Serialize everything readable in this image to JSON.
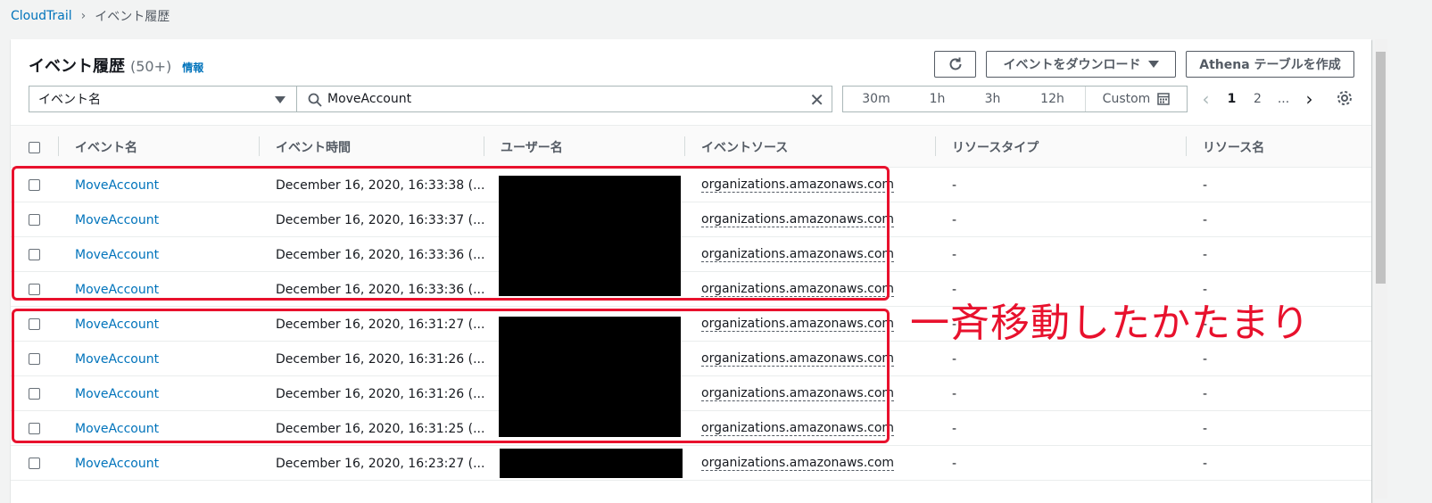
{
  "breadcrumb": {
    "root": "CloudTrail",
    "current": "イベント履歴"
  },
  "header": {
    "title": "イベント履歴",
    "count": "(50+)",
    "info_link": "情報"
  },
  "toolbar": {
    "download_label": "イベントをダウンロード",
    "athena_label": "Athena テーブルを作成"
  },
  "filter": {
    "attribute": "イベント名",
    "search_value": "MoveAccount"
  },
  "time_range": {
    "options": [
      "30m",
      "1h",
      "3h",
      "12h"
    ],
    "custom_label": "Custom"
  },
  "pagination": {
    "pages": [
      "1",
      "2",
      "..."
    ],
    "current": "1"
  },
  "table": {
    "columns": [
      "イベント名",
      "イベント時間",
      "ユーザー名",
      "イベントソース",
      "リソースタイプ",
      "リソース名"
    ],
    "rows": [
      {
        "event_name": "MoveAccount",
        "event_time": "December 16, 2020, 16:33:38 (...",
        "event_source": "organizations.amazonaws.com",
        "resource_type": "-",
        "resource_name": "-"
      },
      {
        "event_name": "MoveAccount",
        "event_time": "December 16, 2020, 16:33:37 (...",
        "event_source": "organizations.amazonaws.com",
        "resource_type": "-",
        "resource_name": "-"
      },
      {
        "event_name": "MoveAccount",
        "event_time": "December 16, 2020, 16:33:36 (...",
        "event_source": "organizations.amazonaws.com",
        "resource_type": "-",
        "resource_name": "-"
      },
      {
        "event_name": "MoveAccount",
        "event_time": "December 16, 2020, 16:33:36 (...",
        "event_source": "organizations.amazonaws.com",
        "resource_type": "-",
        "resource_name": "-"
      },
      {
        "event_name": "MoveAccount",
        "event_time": "December 16, 2020, 16:31:27 (...",
        "event_source": "organizations.amazonaws.com",
        "resource_type": "-",
        "resource_name": "-"
      },
      {
        "event_name": "MoveAccount",
        "event_time": "December 16, 2020, 16:31:26 (...",
        "event_source": "organizations.amazonaws.com",
        "resource_type": "-",
        "resource_name": "-"
      },
      {
        "event_name": "MoveAccount",
        "event_time": "December 16, 2020, 16:31:26 (...",
        "event_source": "organizations.amazonaws.com",
        "resource_type": "-",
        "resource_name": "-"
      },
      {
        "event_name": "MoveAccount",
        "event_time": "December 16, 2020, 16:31:25 (...",
        "event_source": "organizations.amazonaws.com",
        "resource_type": "-",
        "resource_name": "-"
      },
      {
        "event_name": "MoveAccount",
        "event_time": "December 16, 2020, 16:23:27 (...",
        "event_source": "organizations.amazonaws.com",
        "resource_type": "-",
        "resource_name": "-"
      }
    ]
  },
  "annotation": {
    "text": "一斉移動したかたまり",
    "color": "#e8112d"
  },
  "colors": {
    "link": "#0073bb",
    "text": "#16191f",
    "muted": "#545b64"
  },
  "icons": [
    "chevron-right-icon",
    "refresh-icon",
    "caret-down-icon",
    "search-icon",
    "close-icon",
    "calendar-icon",
    "chevron-left-icon",
    "settings-icon"
  ]
}
